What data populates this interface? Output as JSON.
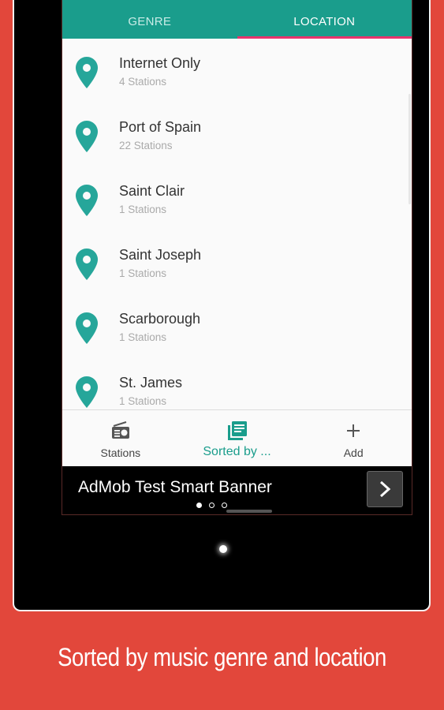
{
  "tabs": [
    {
      "label": "GENRE",
      "icon": "disc-icon",
      "active": false
    },
    {
      "label": "LOCATION",
      "icon": "location-pin-icon",
      "active": true
    }
  ],
  "locations": [
    {
      "name": "Internet Only",
      "count": "4 Stations"
    },
    {
      "name": "Port of Spain",
      "count": "22 Stations"
    },
    {
      "name": "Saint Clair",
      "count": "1 Stations"
    },
    {
      "name": "Saint Joseph",
      "count": "1 Stations"
    },
    {
      "name": "Scarborough",
      "count": "1 Stations"
    },
    {
      "name": "St. James",
      "count": "1 Stations"
    }
  ],
  "bottom_nav": [
    {
      "label": "Stations",
      "icon": "radio-icon"
    },
    {
      "label": "Sorted by ...",
      "icon": "list-icon"
    },
    {
      "label": "Add",
      "icon": "plus-icon"
    }
  ],
  "ad": {
    "text": "AdMob Test Smart Banner",
    "button_icon": "chevron-right-icon"
  },
  "caption": "Sorted by music genre and location",
  "colors": {
    "background": "#e2473b",
    "accent": "#1a9d8c",
    "tab_indicator": "#e8336d"
  }
}
